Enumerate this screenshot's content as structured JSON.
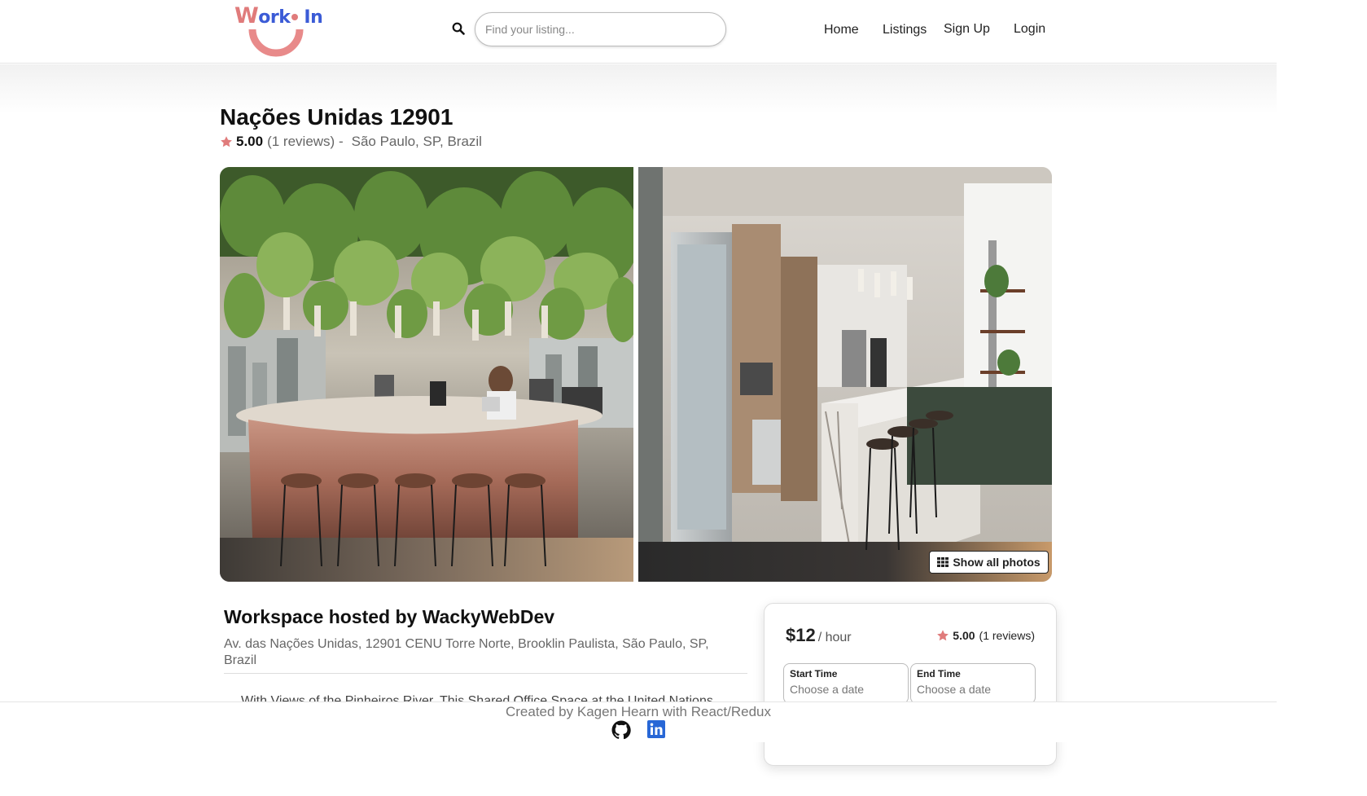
{
  "header": {
    "logo": {
      "w": "W",
      "ork": "ork",
      "in": "In"
    },
    "search_placeholder": "Find your listing...",
    "nav": {
      "home": "Home",
      "listings": "Listings",
      "signup": "Sign Up",
      "login": "Login"
    }
  },
  "listing": {
    "title": "Nações Unidas 12901",
    "rating": "5.00",
    "reviews": "(1 reviews) -",
    "location": "São Paulo, SP, Brazil",
    "show_all_photos": "Show all photos",
    "host_title": "Workspace hosted by WackyWebDev",
    "address": "Av. das Nações Unidas, 12901 CENU Torre Norte, Brooklin Paulista, São Paulo, SP, Brazil",
    "description": "With Views of the Pinheiros River, This Shared Office Space at the United Nations"
  },
  "booking": {
    "price": "$12",
    "per": "/ hour",
    "rating": "5.00",
    "reviews": "(1 reviews)",
    "start_label": "Start Time",
    "start_value": "Choose a date",
    "end_label": "End Time",
    "end_value": "Choose a date"
  },
  "footer": {
    "text": "Created by Kagen Hearn with React/Redux"
  },
  "icons": {
    "search": "search-icon",
    "star": "star-icon",
    "grid": "grid-icon",
    "github": "github-icon",
    "linkedin": "linkedin-icon"
  },
  "colors": {
    "accent": "#e07b7b",
    "brand_blue": "#3b5bd6",
    "linkedin": "#2867d6"
  }
}
